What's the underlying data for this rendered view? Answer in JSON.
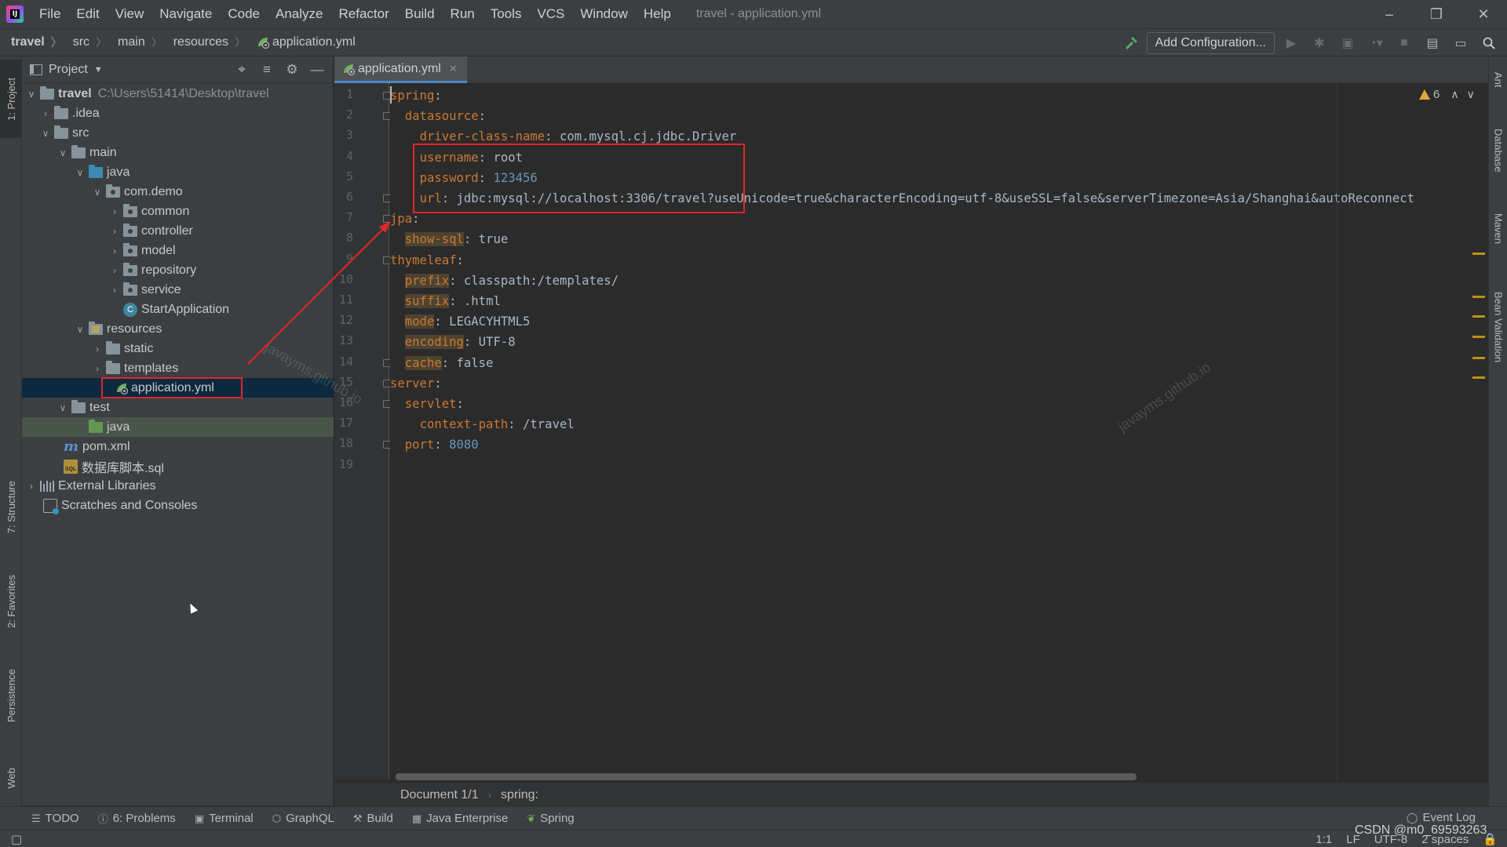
{
  "app": {
    "title": "travel - application.yml",
    "logo_text": "IJ",
    "menu": [
      "File",
      "Edit",
      "View",
      "Navigate",
      "Code",
      "Analyze",
      "Refactor",
      "Build",
      "Run",
      "Tools",
      "VCS",
      "Window",
      "Help"
    ]
  },
  "breadcrumb": {
    "items": [
      "travel",
      "src",
      "main",
      "resources",
      "application.yml"
    ]
  },
  "toolbar": {
    "add_configuration": "Add Configuration..."
  },
  "left_tabs": {
    "project": "1: Project",
    "structure": "7: Structure",
    "favorites": "2: Favorites",
    "persistence": "Persistence",
    "web": "Web"
  },
  "right_tabs": {
    "ant": "Ant",
    "database": "Database",
    "maven": "Maven",
    "bean_validation": "Bean Validation"
  },
  "project_panel": {
    "title": "Project",
    "tree": [
      {
        "label": "travel",
        "path": "C:\\Users\\51414\\Desktop\\travel"
      },
      {
        "label": ".idea"
      },
      {
        "label": "src"
      },
      {
        "label": "main"
      },
      {
        "label": "java"
      },
      {
        "label": "com.demo"
      },
      {
        "label": "common"
      },
      {
        "label": "controller"
      },
      {
        "label": "model"
      },
      {
        "label": "repository"
      },
      {
        "label": "service"
      },
      {
        "label": "StartApplication"
      },
      {
        "label": "resources"
      },
      {
        "label": "static"
      },
      {
        "label": "templates"
      },
      {
        "label": "application.yml"
      },
      {
        "label": "test"
      },
      {
        "label": "java"
      },
      {
        "label": "pom.xml"
      },
      {
        "label": "数据库脚本.sql"
      },
      {
        "label": "External Libraries"
      },
      {
        "label": "Scratches and Consoles"
      }
    ]
  },
  "editor": {
    "tab_label": "application.yml",
    "warnings_count": "6",
    "lines": [
      {
        "n": "1",
        "key": "spring",
        "value": ""
      },
      {
        "n": "2",
        "key": "datasource",
        "value": ""
      },
      {
        "n": "3",
        "key": "driver-class-name",
        "value": "com.mysql.cj.jdbc.Driver"
      },
      {
        "n": "4",
        "key": "username",
        "value": "root"
      },
      {
        "n": "5",
        "key": "password",
        "value": "123456"
      },
      {
        "n": "6",
        "key": "url",
        "value": "jdbc:mysql://localhost:3306/travel?useUnicode=true&characterEncoding=utf-8&useSSL=false&serverTimezone=Asia/Shanghai&autoReconnect"
      },
      {
        "n": "7",
        "key": "jpa",
        "value": ""
      },
      {
        "n": "8",
        "key": "show-sql",
        "value": "true"
      },
      {
        "n": "9",
        "key": "thymeleaf",
        "value": ""
      },
      {
        "n": "10",
        "key": "prefix",
        "value": "classpath:/templates/"
      },
      {
        "n": "11",
        "key": "suffix",
        "value": ".html"
      },
      {
        "n": "12",
        "key": "mode",
        "value": "LEGACYHTML5"
      },
      {
        "n": "13",
        "key": "encoding",
        "value": "UTF-8"
      },
      {
        "n": "14",
        "key": "cache",
        "value": "false"
      },
      {
        "n": "15",
        "key": "server",
        "value": ""
      },
      {
        "n": "16",
        "key": "servlet",
        "value": ""
      },
      {
        "n": "17",
        "key": "context-path",
        "value": "/travel"
      },
      {
        "n": "18",
        "key": "port",
        "value": "8080"
      },
      {
        "n": "19",
        "key": "",
        "value": ""
      }
    ],
    "breadcrumb_doc": "Document 1/1",
    "breadcrumb_node": "spring:"
  },
  "bottom_tools": [
    "TODO",
    "6: Problems",
    "Terminal",
    "GraphQL",
    "Build",
    "Java Enterprise",
    "Spring"
  ],
  "event_log": "Event Log",
  "status": {
    "position": "1:1",
    "line_sep": "LF",
    "encoding": "UTF-8",
    "indent": "2 spaces"
  },
  "watermarks": {
    "csdn": "CSDN @m0_69593263",
    "site1": "javayms.github.io",
    "site2": "javayms.github.io"
  },
  "colors": {
    "annotation": "#e0252a",
    "key": "#cc7832",
    "value": "#a9b7c6",
    "number": "#6897bb"
  }
}
